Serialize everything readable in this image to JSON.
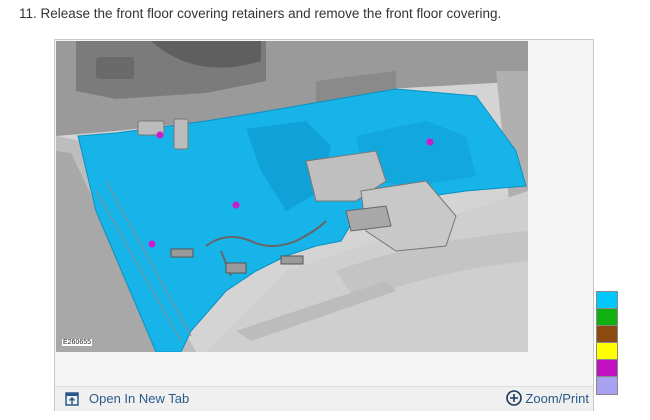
{
  "step": {
    "text": "11. Release the front floor covering retainers and remove the front floor covering."
  },
  "figure": {
    "id_label": "E260655"
  },
  "actions": {
    "open_new_tab": "Open In New Tab",
    "zoom_print": "Zoom/Print"
  },
  "legend": {
    "colors": [
      "#00c8ff",
      "#10b010",
      "#8b4a10",
      "#ffff00",
      "#c010c0",
      "#a8a0f0"
    ]
  },
  "colors": {
    "floor_covering": "#17b4ea",
    "retainer_marker": "#cc1acc",
    "link": "#2a5a8a"
  }
}
